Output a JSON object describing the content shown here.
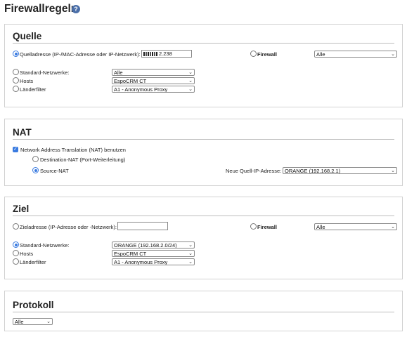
{
  "page": {
    "title": "Firewallregeln",
    "help_icon": "help-icon"
  },
  "quelle": {
    "heading": "Quelle",
    "source_address_label": "Quelladresse (IP-/MAC-Adresse oder IP-Netzwerk):",
    "source_address_value": "2.238",
    "firewall_label": "Firewall",
    "firewall_value": "Alle",
    "standard_networks_label": "Standard-Netzwerke:",
    "standard_networks_value": "Alle",
    "hosts_label": "Hosts",
    "hosts_value": "EspoCRM CT",
    "country_filter_label": "Länderfilter",
    "country_filter_value": "A1 - Anonymous Proxy"
  },
  "nat": {
    "heading": "NAT",
    "use_nat_label": "Network Address Translation (NAT) benutzen",
    "destination_nat_label": "Destination-NAT (Port-Weiterleitung)",
    "source_nat_label": "Source-NAT",
    "new_source_ip_label": "Neue Quell-IP-Adresse:",
    "new_source_ip_value": "ORANGE (192.168.2.1)"
  },
  "ziel": {
    "heading": "Ziel",
    "target_address_label": "Zieladresse (IP-Adresse oder -Netzwerk):",
    "target_address_value": "",
    "firewall_label": "Firewall",
    "firewall_value": "Alle",
    "standard_networks_label": "Standard-Netzwerke:",
    "standard_networks_value": "ORANGE (192.168.2.0/24)",
    "hosts_label": "Hosts",
    "hosts_value": "EspoCRM CT",
    "country_filter_label": "Länderfilter",
    "country_filter_value": "A1 - Anonymous Proxy"
  },
  "protokoll": {
    "heading": "Protokoll",
    "protocol_value": "Alle"
  },
  "colors": {
    "accent": "#3a7be0",
    "border": "#d2d2d2",
    "help_icon": "#4a6ea8"
  }
}
